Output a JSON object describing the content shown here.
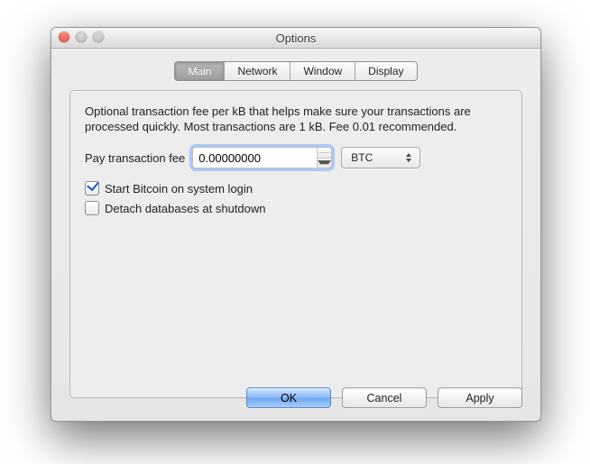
{
  "window": {
    "title": "Options"
  },
  "tabs": {
    "main": "Main",
    "network": "Network",
    "window": "Window",
    "display": "Display"
  },
  "main_panel": {
    "description": "Optional transaction fee per kB that helps make sure your transactions are processed quickly. Most transactions are 1 kB. Fee 0.01 recommended.",
    "fee_label": "Pay transaction fee",
    "fee_value": "0.00000000",
    "unit_selected": "BTC",
    "check_start_label": "Start Bitcoin on system login",
    "check_start_checked": true,
    "check_detach_label": "Detach databases at shutdown",
    "check_detach_checked": false
  },
  "buttons": {
    "ok": "OK",
    "cancel": "Cancel",
    "apply": "Apply"
  }
}
